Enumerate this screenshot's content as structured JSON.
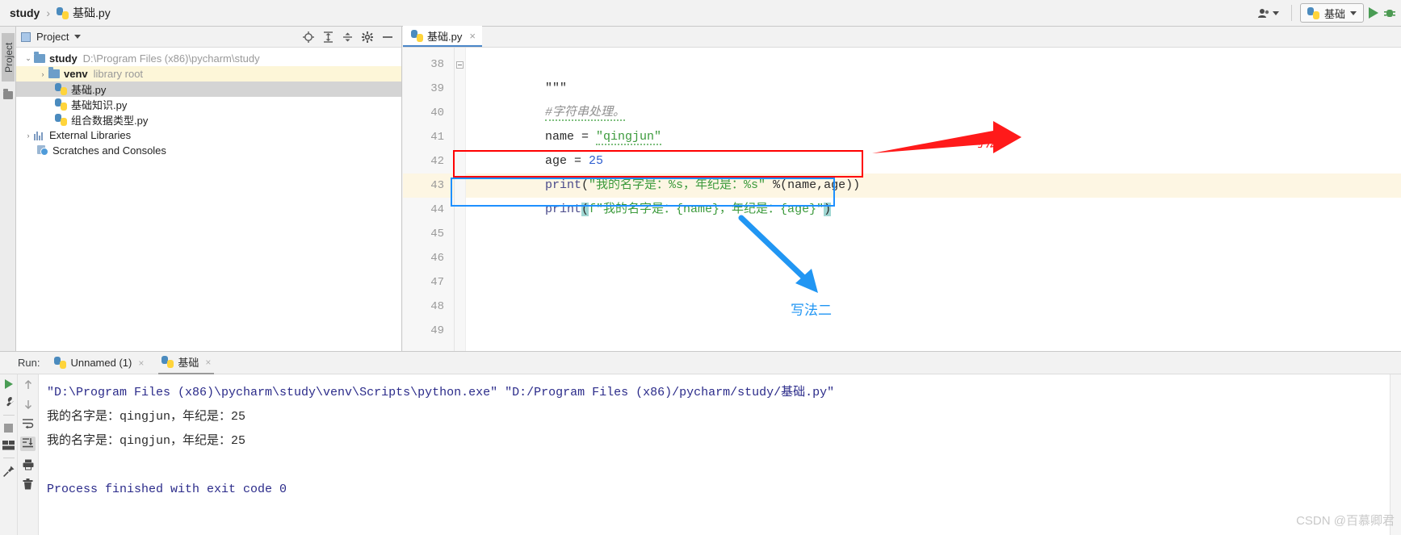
{
  "window": {
    "breadcrumb_root": "study",
    "breadcrumb_sep": "›",
    "breadcrumb_file": "基础.py",
    "run_config_name": "基础",
    "profile_icon": "user-icon",
    "run_icon": "run-triangle-icon",
    "debug_icon": "debug-bug-icon"
  },
  "left_strip": {
    "label": "Project",
    "folder_icon": "folder-icon"
  },
  "project_panel": {
    "title": "Project",
    "dropdown_icon": "chevron-down-icon",
    "header_icons": [
      "locate-target-icon",
      "expand-all-icon",
      "collapse-all-icon",
      "gear-icon",
      "minimize-icon"
    ],
    "tree": [
      {
        "name": "study",
        "detail": "D:\\Program Files (x86)\\pycharm\\study",
        "icon": "folder-icon",
        "arrow": "⌄",
        "depth": 0,
        "bold": true,
        "state": "normal"
      },
      {
        "name": "venv",
        "detail": "library root",
        "icon": "folder-icon",
        "arrow": "›",
        "depth": 1,
        "bold": true,
        "state": "highlight"
      },
      {
        "name": "基础.py",
        "detail": "",
        "icon": "python-file-icon",
        "arrow": "",
        "depth": 2,
        "bold": false,
        "state": "selected"
      },
      {
        "name": "基础知识.py",
        "detail": "",
        "icon": "python-file-icon",
        "arrow": "",
        "depth": 2,
        "bold": false,
        "state": "normal"
      },
      {
        "name": "组合数据类型.py",
        "detail": "",
        "icon": "python-file-icon",
        "arrow": "",
        "depth": 2,
        "bold": false,
        "state": "normal"
      },
      {
        "name": "External Libraries",
        "detail": "",
        "icon": "libraries-icon",
        "arrow": "›",
        "depth": 0,
        "bold": false,
        "state": "normal"
      },
      {
        "name": "Scratches and Consoles",
        "detail": "",
        "icon": "scratches-icon",
        "arrow": "",
        "depth": 1,
        "bold": false,
        "state": "normal"
      }
    ]
  },
  "editor": {
    "tab_title": "基础.py",
    "tab_close": "×",
    "lines": [
      {
        "no": "38",
        "highlight": false,
        "fold": true,
        "tokens": [
          {
            "t": "\"\"\"",
            "c": "k-plain"
          }
        ]
      },
      {
        "no": "39",
        "highlight": false,
        "fold": false,
        "tokens": [
          {
            "t": "#字符串处理。",
            "c": "k-com"
          }
        ]
      },
      {
        "no": "40",
        "highlight": false,
        "fold": false,
        "tokens": [
          {
            "t": "name = ",
            "c": "k-plain"
          },
          {
            "t": "\"qingjun\"",
            "c": "k-str"
          }
        ]
      },
      {
        "no": "41",
        "highlight": false,
        "fold": false,
        "tokens": [
          {
            "t": "age = ",
            "c": "k-plain"
          },
          {
            "t": "25",
            "c": "k-num"
          }
        ]
      },
      {
        "no": "42",
        "highlight": false,
        "fold": false,
        "tokens": [
          {
            "t": "print",
            "c": "k-fn"
          },
          {
            "t": "(",
            "c": "k-plain"
          },
          {
            "t": "\"我的名字是：%s，年纪是：%s\"",
            "c": "k-str"
          },
          {
            "t": " %(name,age))",
            "c": "k-plain"
          }
        ]
      },
      {
        "no": "43",
        "highlight": true,
        "fold": false,
        "tokens": [
          {
            "t": "print",
            "c": "k-fn"
          },
          {
            "t": "(",
            "c": "k-plain"
          },
          {
            "t": "f\"我的名字是：{name}，年纪是：{age}\"",
            "c": "k-str"
          },
          {
            "t": ")",
            "c": "k-plain"
          }
        ]
      },
      {
        "no": "44",
        "highlight": false,
        "fold": false,
        "tokens": []
      },
      {
        "no": "45",
        "highlight": false,
        "fold": false,
        "tokens": []
      },
      {
        "no": "46",
        "highlight": false,
        "fold": false,
        "tokens": []
      },
      {
        "no": "47",
        "highlight": false,
        "fold": false,
        "tokens": []
      },
      {
        "no": "48",
        "highlight": false,
        "fold": false,
        "tokens": []
      },
      {
        "no": "49",
        "highlight": false,
        "fold": false,
        "tokens": []
      }
    ]
  },
  "annotations": {
    "red_label": "写法一",
    "blue_label": "写法二",
    "red_color": "#ff0000",
    "blue_color": "#1e90ff"
  },
  "run_panel": {
    "label": "Run:",
    "tabs": [
      {
        "title": "Unnamed (1)",
        "close": "×",
        "active": false
      },
      {
        "title": "基础",
        "close": "×",
        "active": true
      }
    ],
    "toolbar_left": [
      "run-icon",
      "wrench-icon",
      "stop-icon",
      "layout-icon",
      "pin-icon"
    ],
    "toolbar_right": [
      "scroll-up-icon",
      "scroll-down-icon",
      "soft-wrap-icon",
      "scroll-to-end-icon",
      "print-icon",
      "trash-icon"
    ],
    "output": [
      {
        "text": "\"D:\\Program Files (x86)\\pycharm\\study\\venv\\Scripts\\python.exe\" \"D:/Program Files (x86)/pycharm/study/基础.py\"",
        "color": "blue"
      },
      {
        "text": "我的名字是：qingjun，年纪是：25",
        "color": "dark"
      },
      {
        "text": "我的名字是：qingjun，年纪是：25",
        "color": "dark"
      },
      {
        "text": "",
        "color": "dark"
      },
      {
        "text": "Process finished with exit code 0",
        "color": "blue"
      }
    ]
  },
  "watermark": "CSDN @百慕卿君"
}
